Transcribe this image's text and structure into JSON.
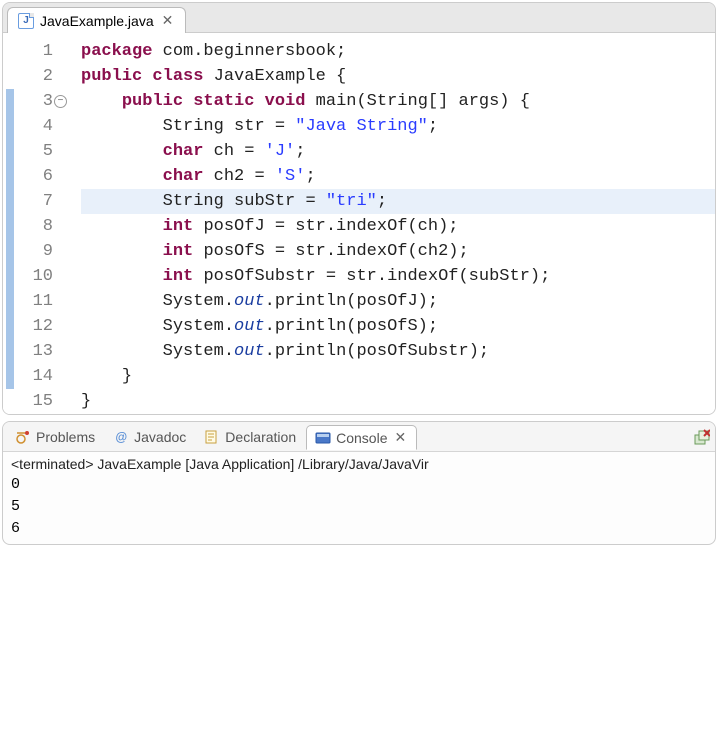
{
  "editor": {
    "tab": {
      "filename": "JavaExample.java",
      "icon_letter": "J"
    },
    "lines": [
      {
        "n": 1,
        "mark": false,
        "hl": false,
        "fold": "",
        "html": "<span class='kw'>package</span> <span class='plain'>com.beginnersbook;</span>"
      },
      {
        "n": 2,
        "mark": false,
        "hl": false,
        "fold": "",
        "html": "<span class='kw'>public</span> <span class='kw'>class</span> <span class='plain'>JavaExample {</span>"
      },
      {
        "n": 3,
        "mark": true,
        "hl": false,
        "fold": "minus",
        "html": "    <span class='kw'>public</span> <span class='kw'>static</span> <span class='kw'>void</span> <span class='plain'>main(String[] args) {</span>"
      },
      {
        "n": 4,
        "mark": true,
        "hl": false,
        "fold": "",
        "html": "        <span class='plain'>String str = </span><span class='str'>\"Java String\"</span><span class='plain'>;</span>"
      },
      {
        "n": 5,
        "mark": true,
        "hl": false,
        "fold": "",
        "html": "        <span class='kw'>char</span> <span class='plain'>ch = </span><span class='chr'>'J'</span><span class='plain'>;</span>"
      },
      {
        "n": 6,
        "mark": true,
        "hl": false,
        "fold": "",
        "html": "        <span class='kw'>char</span> <span class='plain'>ch2 = </span><span class='chr'>'S'</span><span class='plain'>;</span>"
      },
      {
        "n": 7,
        "mark": true,
        "hl": true,
        "fold": "",
        "html": "        <span class='plain'>String subStr = </span><span class='str'>\"tri\"</span><span class='plain'>;</span>"
      },
      {
        "n": 8,
        "mark": true,
        "hl": false,
        "fold": "",
        "html": "        <span class='kw'>int</span> <span class='plain'>posOfJ = str.indexOf(ch);</span>"
      },
      {
        "n": 9,
        "mark": true,
        "hl": false,
        "fold": "",
        "html": "        <span class='kw'>int</span> <span class='plain'>posOfS = str.indexOf(ch2);</span>"
      },
      {
        "n": 10,
        "mark": true,
        "hl": false,
        "fold": "",
        "html": "        <span class='kw'>int</span> <span class='plain'>posOfSubstr = str.indexOf(subStr);</span>"
      },
      {
        "n": 11,
        "mark": true,
        "hl": false,
        "fold": "",
        "html": "        <span class='plain'>System.</span><span class='field'>out</span><span class='plain'>.println(posOfJ);</span>"
      },
      {
        "n": 12,
        "mark": true,
        "hl": false,
        "fold": "",
        "html": "        <span class='plain'>System.</span><span class='field'>out</span><span class='plain'>.println(posOfS);</span>"
      },
      {
        "n": 13,
        "mark": true,
        "hl": false,
        "fold": "",
        "html": "        <span class='plain'>System.</span><span class='field'>out</span><span class='plain'>.println(posOfSubstr);</span>"
      },
      {
        "n": 14,
        "mark": true,
        "hl": false,
        "fold": "",
        "html": "    <span class='plain'>}</span>"
      },
      {
        "n": 15,
        "mark": false,
        "hl": false,
        "fold": "",
        "html": "<span class='plain'>}</span>"
      }
    ]
  },
  "bottom": {
    "tabs": {
      "problems": "Problems",
      "javadoc": "Javadoc",
      "declaration": "Declaration",
      "console": "Console"
    },
    "console": {
      "status": "<terminated> JavaExample [Java Application] /Library/Java/JavaVir",
      "output": [
        "0",
        "5",
        "6"
      ]
    }
  }
}
